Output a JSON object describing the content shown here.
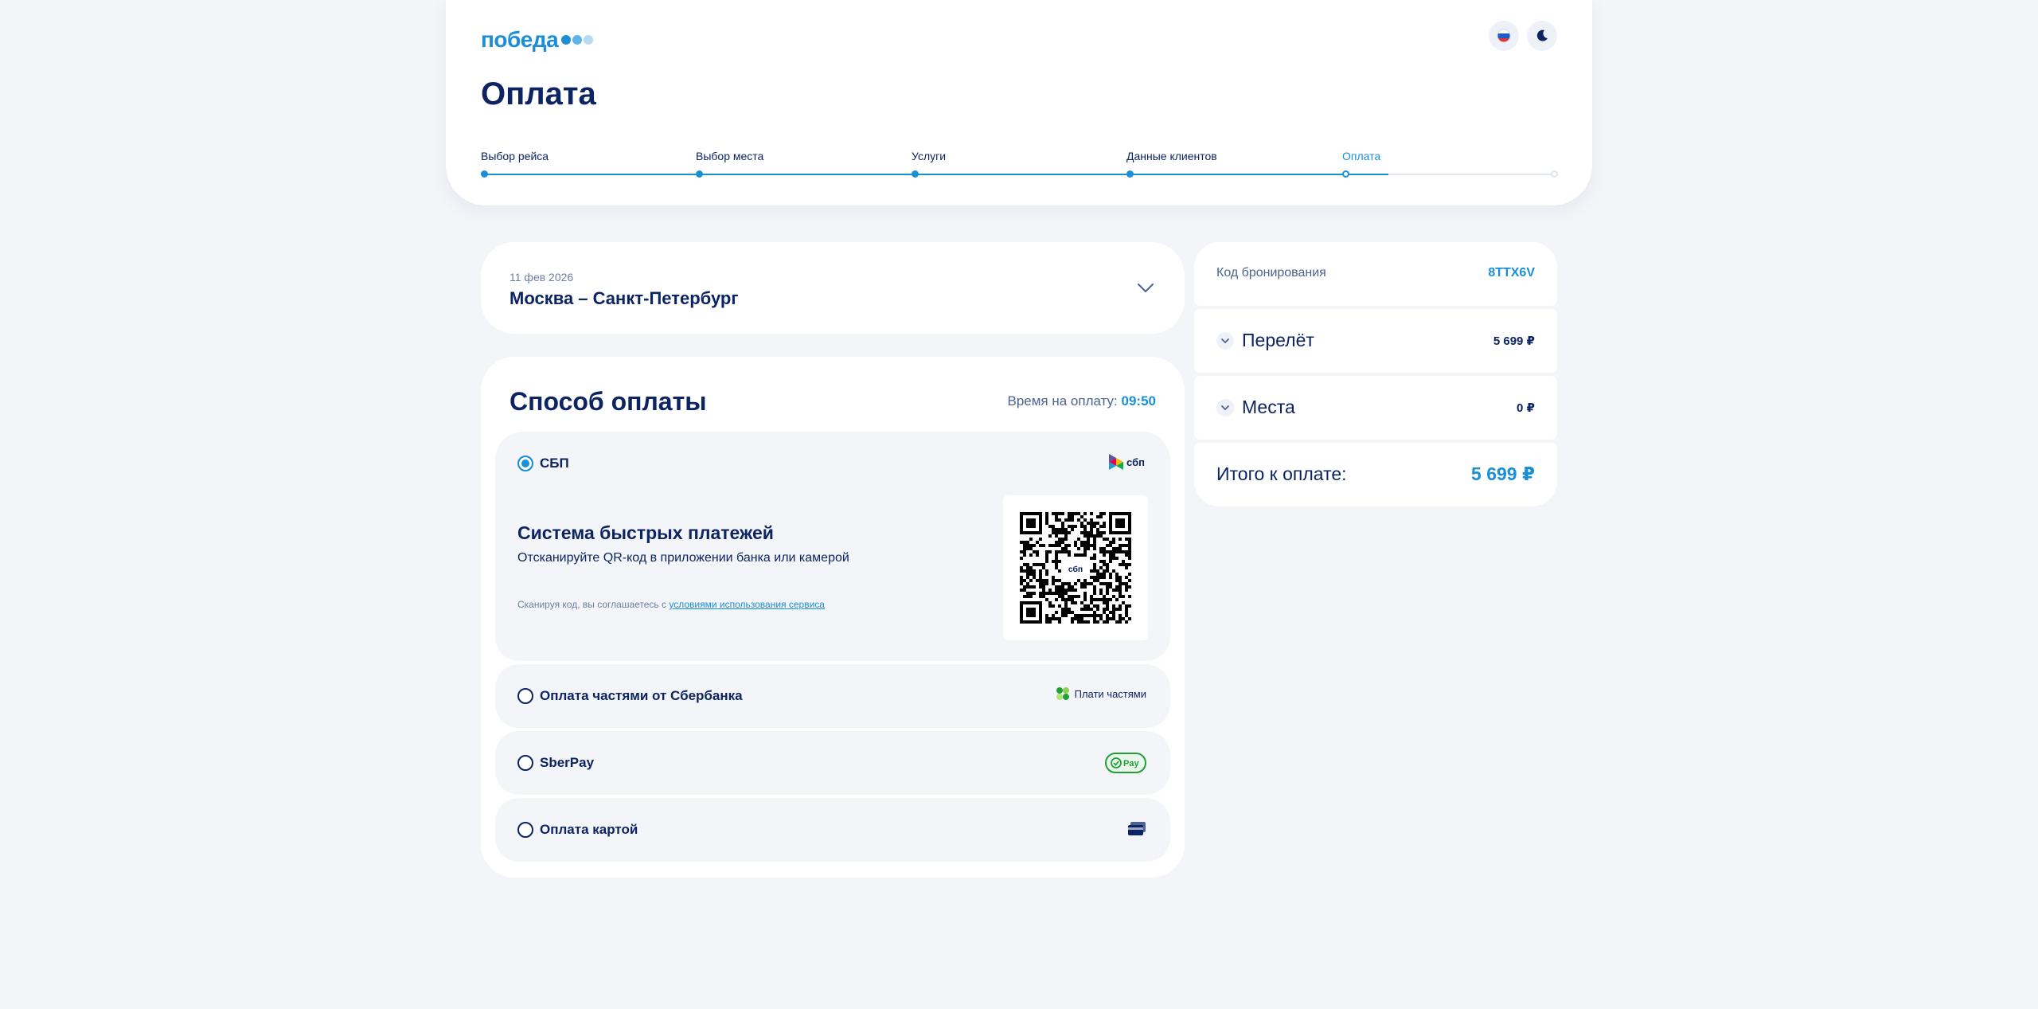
{
  "header": {
    "logo_text": "победа",
    "page_title": "Оплата",
    "steps": [
      {
        "label": "Выбор рейса"
      },
      {
        "label": "Выбор места"
      },
      {
        "label": "Услуги"
      },
      {
        "label": "Данные клиентов"
      },
      {
        "label": "Оплата"
      }
    ],
    "current_step": "Оплата"
  },
  "flight": {
    "date": "11 фев 2026",
    "route": "Москва – Санкт-Петербург"
  },
  "payment": {
    "title": "Способ оплаты",
    "timer_label": "Время на оплату:",
    "timer_value": "09:50",
    "options": [
      {
        "label": "СБП",
        "selected": true,
        "logo_text": "сбп"
      },
      {
        "label": "Оплата частями от Сбербанка",
        "selected": false,
        "logo_text": "Плати частями"
      },
      {
        "label": "SberPay",
        "selected": false,
        "logo_text": "Pay"
      },
      {
        "label": "Оплата картой",
        "selected": false
      }
    ],
    "sbp": {
      "heading": "Система быстрых платежей",
      "subtext": "Отсканируйте QR-код в приложении банка или камерой",
      "terms_prefix": "Сканируя код, вы соглашаетесь с",
      "terms_link": "условиями использования сервиса",
      "qr_center_text": "сбп"
    }
  },
  "summary": {
    "booking_label": "Код бронирования",
    "booking_code": "8TTX6V",
    "flight_label": "Перелёт",
    "flight_price": "5 699 ₽",
    "seats_label": "Места",
    "seats_price": "0 ₽",
    "total_label": "Итого к оплате:",
    "total_price": "5 699 ₽"
  },
  "colors": {
    "accent": "#1a8fd6",
    "navy": "#0d2463",
    "background": "#f3f5f9",
    "sberpay_green": "#21a038"
  }
}
